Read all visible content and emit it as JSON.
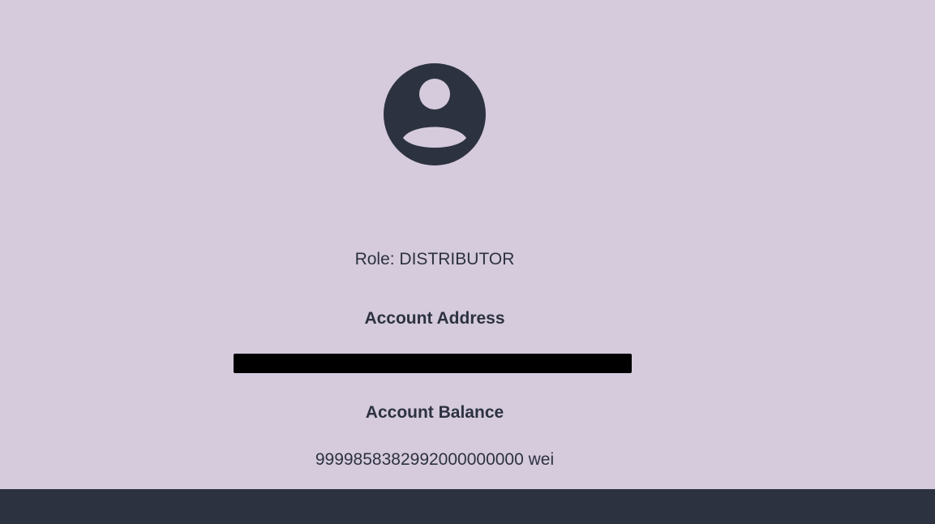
{
  "profile": {
    "avatar_icon": "account-circle-icon",
    "role_prefix": "Role: ",
    "role_value": "DISTRIBUTOR",
    "role_text": "Role: DISTRIBUTOR",
    "address_heading": "Account Address",
    "balance_heading": "Account Balance",
    "balance_text": "9999858382992000000000 wei"
  },
  "colors": {
    "background": "#d5cbdd",
    "text": "#2d3240",
    "footer": "#2d3240",
    "redaction": "#000000"
  }
}
